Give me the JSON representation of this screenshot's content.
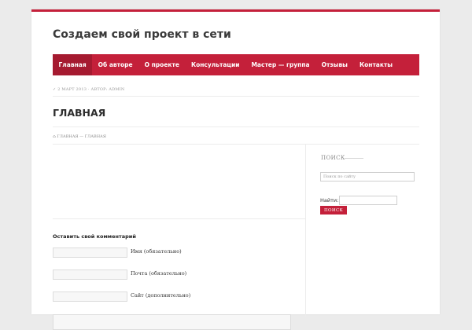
{
  "site": {
    "title": "Создаем свой проект в сети"
  },
  "colors": {
    "accent": "#c4203a",
    "accent_dark": "#a51a30",
    "background": "#ebebeb"
  },
  "nav": {
    "items": [
      {
        "label": "Главная",
        "active": true
      },
      {
        "label": "Об авторе"
      },
      {
        "label": "О проекте"
      },
      {
        "label": "Консультации"
      },
      {
        "label": "Мастер — группа"
      },
      {
        "label": "Отзывы"
      },
      {
        "label": "Контакты"
      }
    ]
  },
  "meta": {
    "date": "2 МАРТ 2013",
    "separator": "·",
    "author": "АВТОР: ADMIN",
    "icon": "calendar-icon"
  },
  "page": {
    "title": "ГЛАВНАЯ"
  },
  "breadcrumb": {
    "home": "ГЛАВНАЯ",
    "separator": "—",
    "current": "ГЛАВНАЯ",
    "icon": "home-icon"
  },
  "comment_form": {
    "title": "Оставить свой комментарий",
    "fields": [
      {
        "label": "Имя (обязательно)",
        "value": ""
      },
      {
        "label": "Почта (обязательно)",
        "value": ""
      },
      {
        "label": "Сайт (дополнительно)",
        "value": ""
      }
    ]
  },
  "sidebar": {
    "widget_title": "ПОИСК",
    "search_placeholder": "Поиск по сайту",
    "find_label": "Найти:",
    "button_label": "ПОИСК"
  }
}
